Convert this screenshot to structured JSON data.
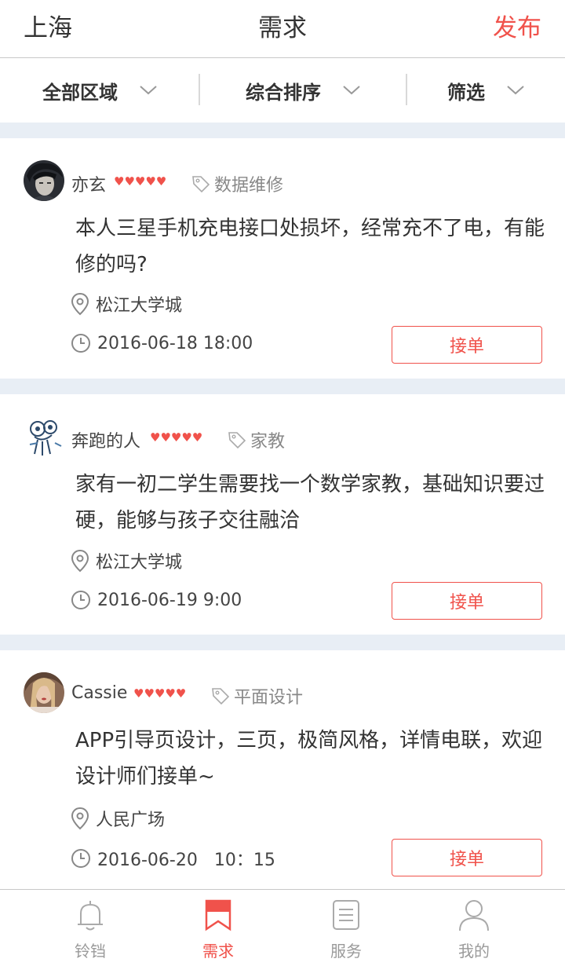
{
  "header": {
    "city": "上海",
    "title": "需求",
    "publish": "发布"
  },
  "filters": [
    {
      "label": "全部区域"
    },
    {
      "label": "综合排序"
    },
    {
      "label": "筛选"
    }
  ],
  "rating_symbol": "♥♥♥♥♥",
  "posts": [
    {
      "user": "亦玄",
      "rating": 5,
      "tag": "数据维修",
      "content": "本人三星手机充电接口处损坏，经常充不了电，有能修的吗?",
      "location": "松江大学城",
      "time": "2016-06-18 18:00",
      "action": "接单"
    },
    {
      "user": "奔跑的人",
      "rating": 5,
      "tag": "家教",
      "content": "家有一初二学生需要找一个数学家教，基础知识要过硬，能够与孩子交往融洽",
      "location": "松江大学城",
      "time": "2016-06-19 9:00",
      "action": "接单"
    },
    {
      "user": "Cassie",
      "rating": 5,
      "tag": "平面设计",
      "content": "APP引导页设计，三页，极简风格，详情电联，欢迎设计师们接单~",
      "location": "人民广场",
      "time": "2016-06-20   10：15",
      "action": "接单"
    }
  ],
  "tabs": [
    {
      "label": "铃铛",
      "icon": "bell-icon",
      "active": false
    },
    {
      "label": "需求",
      "icon": "bookmark-icon",
      "active": true
    },
    {
      "label": "服务",
      "icon": "list-icon",
      "active": false
    },
    {
      "label": "我的",
      "icon": "person-icon",
      "active": false
    }
  ],
  "colors": {
    "accent": "#f0524b",
    "divider": "#e8eef5",
    "muted": "#9a9a9a"
  }
}
